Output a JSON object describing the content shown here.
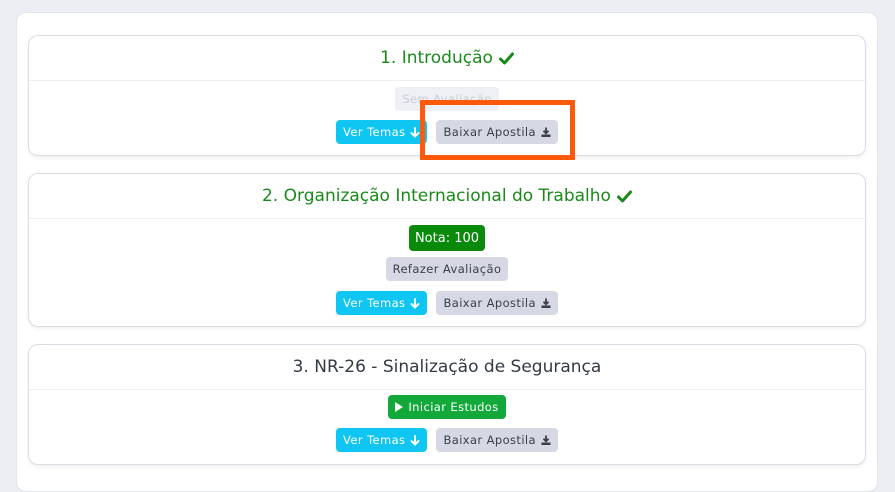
{
  "modules": [
    {
      "title": "1. Introdução",
      "completed": true,
      "status_button": "Sem Avaliação",
      "topics_button": "Ver Temas",
      "download_button": "Baixar Apostila"
    },
    {
      "title": "2. Organização Internacional do Trabalho",
      "completed": true,
      "grade": "Nota: 100",
      "retake_button": "Refazer Avaliação",
      "topics_button": "Ver Temas",
      "download_button": "Baixar Apostila"
    },
    {
      "title": "3. NR-26 - Sinalização de Segurança",
      "completed": false,
      "start_button": "Iniciar Estudos",
      "topics_button": "Ver Temas",
      "download_button": "Baixar Apostila"
    }
  ],
  "colors": {
    "completed_title": "#198a19",
    "cyan_button": "#0fc6f2",
    "gray_button": "#d6d8e3",
    "grade_badge": "#0a8a0a",
    "start_button": "#12a93a",
    "highlight_box": "#ff5a0a"
  }
}
